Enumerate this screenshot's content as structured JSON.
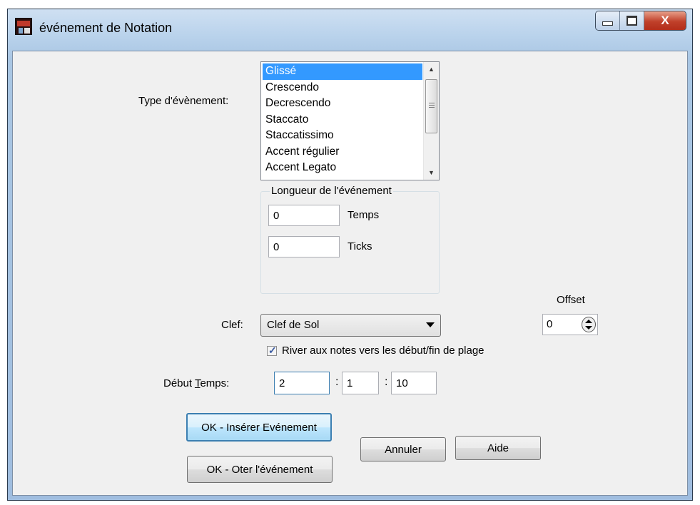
{
  "window": {
    "title": "événement de Notation",
    "close_glyph": "X"
  },
  "event_type": {
    "label": "Type d'évènement:",
    "items": [
      "Glissé",
      "Crescendo",
      "Decrescendo",
      "Staccato",
      "Staccatissimo",
      "Accent régulier",
      "Accent Legato"
    ],
    "selected": "Glissé"
  },
  "length_group": {
    "title": "Longueur de l'événement",
    "temps_value": "0",
    "temps_label": "Temps",
    "ticks_value": "0",
    "ticks_label": "Ticks"
  },
  "offset": {
    "label": "Offset",
    "value": "0"
  },
  "clef": {
    "label": "Clef:",
    "value": "Clef de Sol"
  },
  "snap_checkbox": {
    "label": "River aux notes vers les début/fin de plage",
    "checked": true
  },
  "start_time": {
    "label_before": "Début ",
    "label_underlined": "T",
    "label_after": "emps:",
    "bar": "2",
    "beat": "1",
    "tick": "10",
    "separator": ":"
  },
  "buttons": {
    "insert": "OK - Insérer Evénement",
    "remove": "OK - Oter l'événement",
    "cancel": "Annuler",
    "help": "Aide"
  },
  "colors": {
    "selection": "#3399ff",
    "dialog_bg": "#f0f0f0",
    "close_button": "#c0402a"
  }
}
